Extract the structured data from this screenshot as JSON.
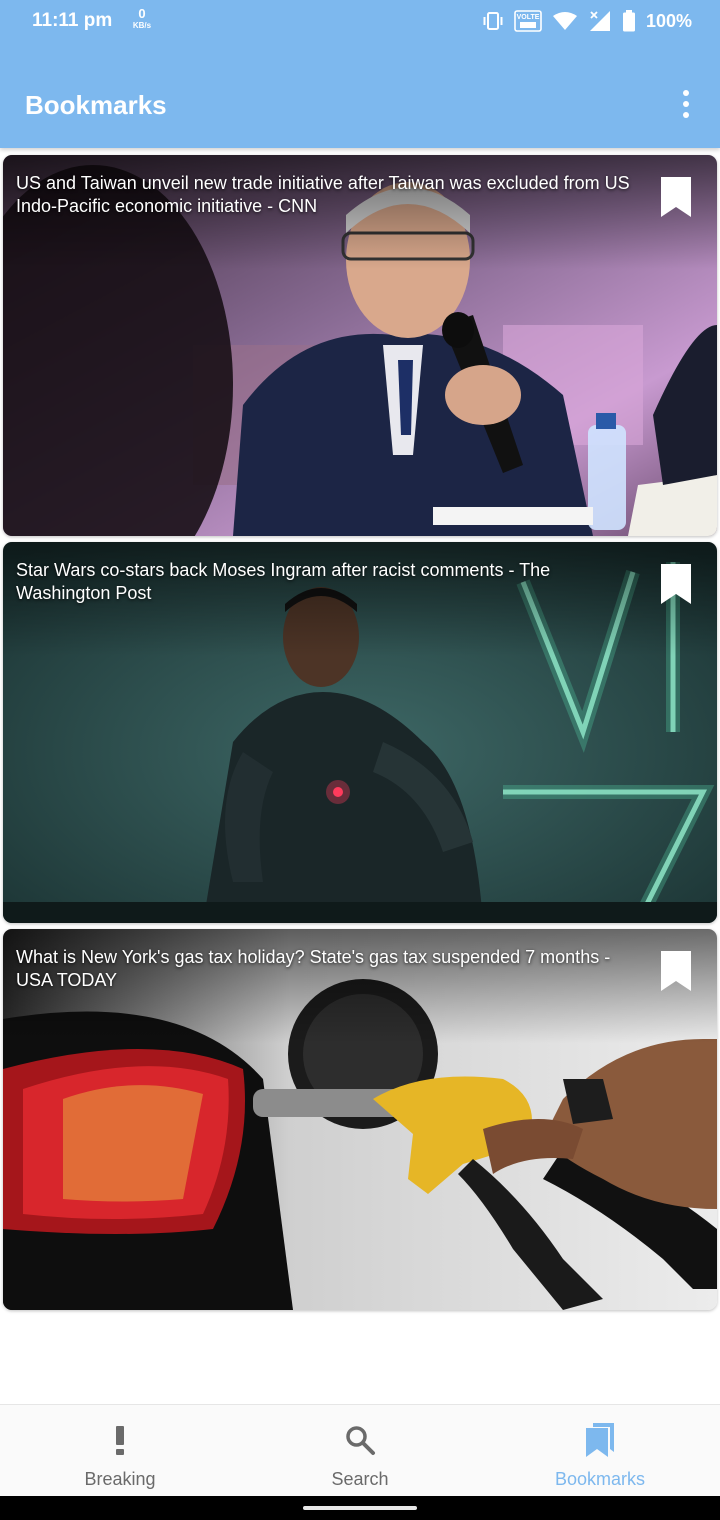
{
  "status_bar": {
    "time": "11:11 pm",
    "net_speed_value": "0",
    "net_speed_unit": "KB/s",
    "volte_label": "VOLTE",
    "battery": "100%"
  },
  "app_bar": {
    "title": "Bookmarks",
    "menu_icon": "more-vert-icon"
  },
  "articles": [
    {
      "title": "US and Taiwan unveil new trade initiative after Taiwan was excluded from US Indo-Pacific economic initiative - CNN",
      "bookmarked": true,
      "image": "press-conference-photo"
    },
    {
      "title": "Star Wars co-stars back Moses Ingram after racist comments - The Washington Post",
      "bookmarked": true,
      "image": "star-wars-character-photo"
    },
    {
      "title": "What is New York's gas tax holiday? State's gas tax suspended 7 months - USA TODAY",
      "bookmarked": true,
      "image": "gas-pump-photo"
    }
  ],
  "bottom_nav": {
    "active": "Bookmarks",
    "items": [
      {
        "label": "Breaking",
        "icon": "exclamation-icon"
      },
      {
        "label": "Search",
        "icon": "search-icon"
      },
      {
        "label": "Bookmarks",
        "icon": "bookmarks-icon"
      }
    ]
  },
  "colors": {
    "primary": "#7db8ee",
    "nav_inactive": "#6a6a6a"
  }
}
